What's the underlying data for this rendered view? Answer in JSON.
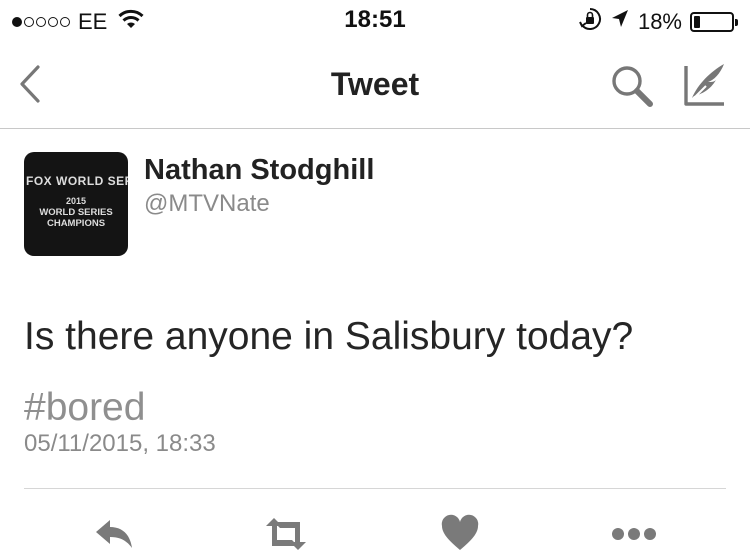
{
  "status_bar": {
    "signal_dots": [
      true,
      false,
      false,
      false,
      false
    ],
    "carrier": "EE",
    "time": "18:51",
    "battery_percent": "18%",
    "battery_level": 0.18
  },
  "nav": {
    "title": "Tweet",
    "back_icon": "chevron-left-icon",
    "search_icon": "search-icon",
    "compose_icon": "compose-quill-icon"
  },
  "tweet": {
    "avatar": {
      "line1": "FOX WORLD SERIES",
      "line2": "2015",
      "line3": "WORLD SERIES",
      "line4": "CHAMPIONS"
    },
    "display_name": "Nathan Stodghill",
    "handle": "@MTVNate",
    "text": "Is there anyone in Salisbury today?",
    "hashtag": "#bored",
    "timestamp": "05/11/2015, 18:33"
  },
  "actions": {
    "reply_icon": "reply-icon",
    "retweet_icon": "retweet-icon",
    "like_icon": "heart-icon",
    "more_icon": "more-dots-icon"
  },
  "colors": {
    "text_primary": "#222222",
    "text_secondary": "#8a8a8a",
    "icon_gray": "#7a7a7a",
    "divider": "#c8c8c8"
  }
}
